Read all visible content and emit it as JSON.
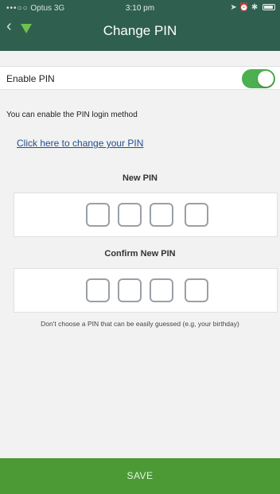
{
  "status_bar": {
    "carrier_signal": "•••○○",
    "carrier": "Optus",
    "network": "3G",
    "time": "3:10 pm"
  },
  "header": {
    "back_icon": "chevron-left-icon",
    "logo_icon": "triangle-logo-icon",
    "title": "Change PIN"
  },
  "enable_pin": {
    "label": "Enable PIN",
    "enabled": true,
    "accent": "#4caf50"
  },
  "info_text": "You can enable the PIN login method",
  "change_link": "Click here to change your PIN",
  "new_pin": {
    "label": "New PIN",
    "digits": [
      "",
      "",
      "",
      ""
    ]
  },
  "confirm_pin": {
    "label": "Confirm New PIN",
    "digits": [
      "",
      "",
      "",
      ""
    ]
  },
  "hint": "Don't choose a PIN that can be easily guessed (e.g, your birthday)",
  "save_label": "SAVE",
  "colors": {
    "header": "#2f5f4f",
    "save": "#4b9a36",
    "link": "#1f4f8f"
  }
}
